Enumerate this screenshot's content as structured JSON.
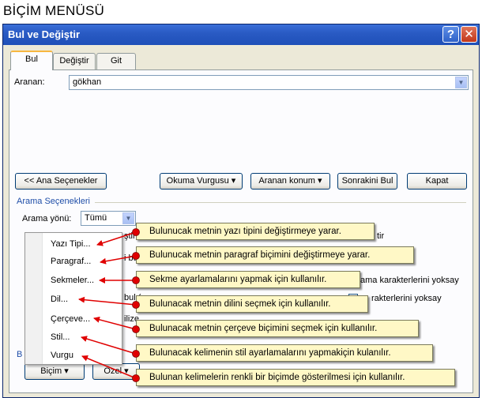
{
  "page_title": "BİÇİM MENÜSÜ",
  "window": {
    "title": "Bul ve Değiştir",
    "help_glyph": "?",
    "close_glyph": "✕"
  },
  "tabs": [
    {
      "label": "Bul",
      "active": true
    },
    {
      "label": "Değiştir",
      "active": false
    },
    {
      "label": "Git",
      "active": false
    }
  ],
  "search": {
    "label": "Aranan:",
    "value": "gökhan"
  },
  "buttons": {
    "less_options": "<< Ana Seçenekler",
    "reading_highlight": "Okuma Vurgusu",
    "find_in": "Aranan konum",
    "find_next": "Sonrakini Bul",
    "close": "Kapat",
    "format": "Biçim",
    "special": "Özel"
  },
  "options": {
    "section_title": "Arama Seçenekleri",
    "direction_label": "Arama yönü:",
    "direction_value": "Tümü"
  },
  "background_fragments": {
    "f1": "ştir",
    "f2": "i bu",
    "f3": "tir",
    "f4": "ama karakterlerini yoksay",
    "f5": "bul (",
    "f6": "rakterlerini yoksay",
    "f7": "ilize",
    "f8": "B"
  },
  "format_menu": [
    {
      "label": "Yazı Tipi..."
    },
    {
      "label": "Paragraf..."
    },
    {
      "label": "Sekmeler..."
    },
    {
      "label": "Dil..."
    },
    {
      "label": "Çerçeve..."
    },
    {
      "label": "Stil..."
    },
    {
      "label": "Vurgu"
    }
  ],
  "callouts": [
    {
      "text": "Bulunucak metnin yazı tipini değiştirmeye yarar."
    },
    {
      "text": "Bulunucak metnin paragraf biçimini değiştirmeye yarar."
    },
    {
      "text": "Sekme ayarlamalarını yapmak için kullanılır."
    },
    {
      "text": "Bulunacak metnin dilini seçmek için kullanılır."
    },
    {
      "text": "Bulunacak metnin çerçeve biçimini seçmek için kullanılır."
    },
    {
      "text": "Bulunacak kelimenin stil ayarlamalarını yapmakiçin kulanılır."
    },
    {
      "text": "Bulunan kelimelerin renkli bir biçimde gösterilmesi için kullanılır."
    }
  ],
  "colors": {
    "arrow": "#e00000",
    "callout_bg": "#fff8c6",
    "title_bar": "#2a5bc4"
  }
}
